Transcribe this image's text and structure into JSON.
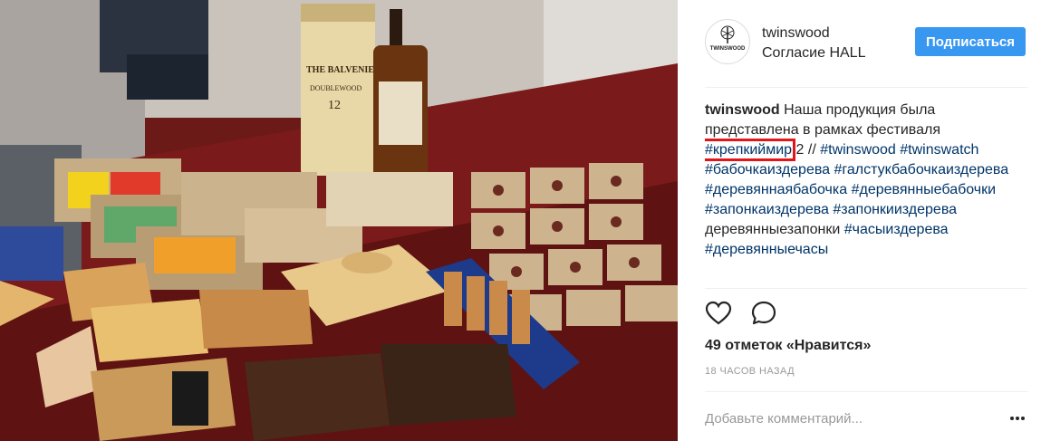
{
  "header": {
    "username": "twinswood",
    "location": "Согласие HALL",
    "follow_label": "Подписаться",
    "avatar_text": "TWINSWOOD"
  },
  "photo": {
    "bottle_label": "THE BALVENIE",
    "bottle_sub": "DOUBLEWOOD",
    "bottle_age": "12"
  },
  "caption": {
    "username": "twinswood",
    "text_1": "Наша продукция была представлена в рамках фестиваля",
    "highlighted_tag": "#крепкиймир",
    "text_2": "2 // ",
    "tags_1": "#twinswood #twinswatch #бабочкаиздерева #галстукбабочкаиздерева #деревяннаябабочка #деревянныебабочки #запонкаиздерева #запонкииздерева",
    "text_3": "деревянныезапонки",
    "tags_2": "#часыиздерева #деревянныечасы"
  },
  "likes": "49 отметок «Нравится»",
  "time": "18 ЧАСОВ НАЗАД",
  "comment": {
    "placeholder": "Добавьте комментарий..."
  },
  "colors": {
    "accent": "#3897f0",
    "tag": "#003569",
    "highlight": "#e3151a"
  },
  "icons": [
    "heart-icon",
    "comment-icon",
    "more-options-icon"
  ]
}
